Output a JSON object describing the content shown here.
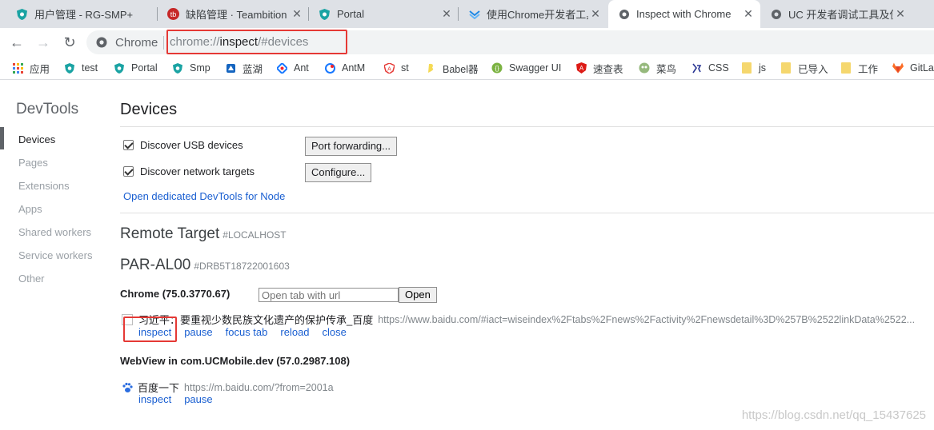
{
  "tabs": [
    {
      "title": "用户管理 - RG-SMP+",
      "icon": "shield-icon",
      "active": false
    },
    {
      "title": "缺陷管理 · Teambition",
      "icon": "teambition-icon",
      "active": false
    },
    {
      "title": "Portal",
      "icon": "shield-icon",
      "active": false
    },
    {
      "title": "使用Chrome开发者工具",
      "icon": "chevron-icon",
      "active": false
    },
    {
      "title": "Inspect with Chrome",
      "icon": "globe-icon",
      "active": true
    },
    {
      "title": "UC 开发者调试工具及使",
      "icon": "globe-icon",
      "active": false
    }
  ],
  "tab_close": "✕",
  "omnibox": {
    "site_label": "Chrome",
    "url_scheme": "chrome://",
    "url_host": "inspect",
    "url_path": "/#devices"
  },
  "bookmarks": [
    {
      "label": "应用",
      "icon": "apps-grid-icon"
    },
    {
      "label": "test",
      "icon": "shield-icon"
    },
    {
      "label": "Portal",
      "icon": "shield-icon"
    },
    {
      "label": "Smp",
      "icon": "shield-icon"
    },
    {
      "label": "蓝湖",
      "icon": "lanhu-icon"
    },
    {
      "label": "Ant",
      "icon": "ant-icon"
    },
    {
      "label": "AntM",
      "icon": "antm-icon"
    },
    {
      "label": "st",
      "icon": "st-icon"
    },
    {
      "label": "Babel器",
      "icon": "babel-icon"
    },
    {
      "label": "Swagger UI",
      "icon": "swagger-icon"
    },
    {
      "label": "速查表",
      "icon": "angular-icon"
    },
    {
      "label": "菜鸟",
      "icon": "runoob-icon"
    },
    {
      "label": "CSS",
      "icon": "css-icon"
    },
    {
      "label": "js",
      "icon": "folder-icon"
    },
    {
      "label": "已导入",
      "icon": "folder-icon"
    },
    {
      "label": "工作",
      "icon": "folder-icon"
    },
    {
      "label": "GitLa",
      "icon": "gitlab-icon"
    }
  ],
  "sidebar": {
    "title": "DevTools",
    "items": [
      "Devices",
      "Pages",
      "Extensions",
      "Apps",
      "Shared workers",
      "Service workers",
      "Other"
    ],
    "active_index": 0
  },
  "main": {
    "title": "Devices",
    "discover_usb_label": "Discover USB devices",
    "discover_usb_checked": true,
    "port_forwarding_button": "Port forwarding...",
    "discover_network_label": "Discover network targets",
    "discover_network_checked": true,
    "configure_button": "Configure...",
    "open_node_link": "Open dedicated DevTools for Node"
  },
  "remote_target": {
    "title": "Remote Target",
    "hash": "#LOCALHOST"
  },
  "device": {
    "name": "PAR-AL00",
    "serial": "#DRB5T18722001603"
  },
  "chrome_browser": {
    "name": "Chrome (75.0.3770.67)",
    "open_tab_placeholder": "Open tab with url",
    "open_button": "Open",
    "page_title": "习近平：要重视少数民族文化遗产的保护传承_百度",
    "page_url": "https://www.baidu.com/#iact=wiseindex%2Ftabs%2Fnews%2Factivity%2Fnewsdetail%3D%257B%2522linkData%2522...",
    "actions": [
      "inspect",
      "pause",
      "focus tab",
      "reload",
      "close"
    ]
  },
  "webview": {
    "name": "WebView in com.UCMobile.dev (57.0.2987.108)",
    "page_title": "百度一下",
    "page_url": "https://m.baidu.com/?from=2001a",
    "actions": [
      "inspect",
      "pause"
    ]
  },
  "watermark": "https://blog.csdn.net/qq_15437625",
  "colors": {
    "highlight": "#e53935",
    "link": "#1a5fd1",
    "tabstrip": "#dee1e6"
  }
}
